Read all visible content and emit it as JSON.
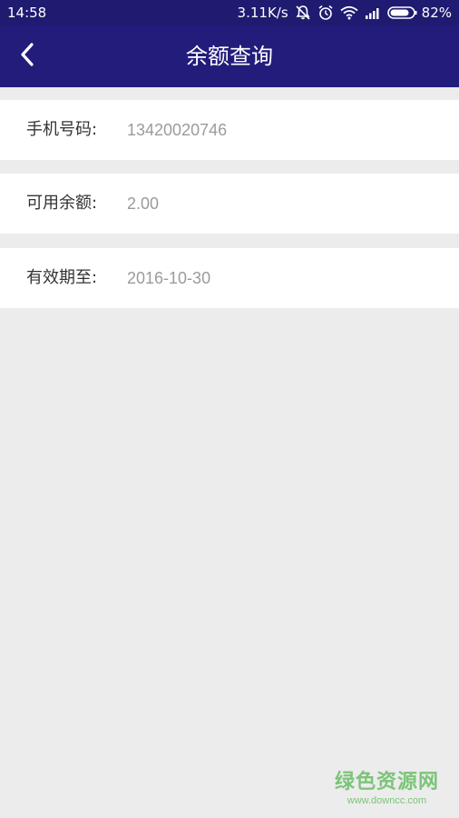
{
  "status_bar": {
    "time": "14:58",
    "network_speed": "3.11K/s",
    "battery": "82%",
    "icons": [
      "mute-icon",
      "alarm-icon",
      "wifi-icon",
      "signal-icon",
      "battery-icon"
    ]
  },
  "header": {
    "back_icon": "chevron-left-icon",
    "title": "余额查询"
  },
  "rows": [
    {
      "label": "手机号码:",
      "value": "13420020746"
    },
    {
      "label": "可用余额:",
      "value": "2.00"
    },
    {
      "label": "有效期至:",
      "value": "2016-10-30"
    }
  ],
  "watermark": {
    "name": "绿色资源网",
    "url": "www.downcc.com"
  },
  "colors": {
    "header_bg": "#221c7b",
    "page_bg": "#ececec",
    "value_text": "#9b9b9b",
    "watermark": "#7cc47a"
  }
}
